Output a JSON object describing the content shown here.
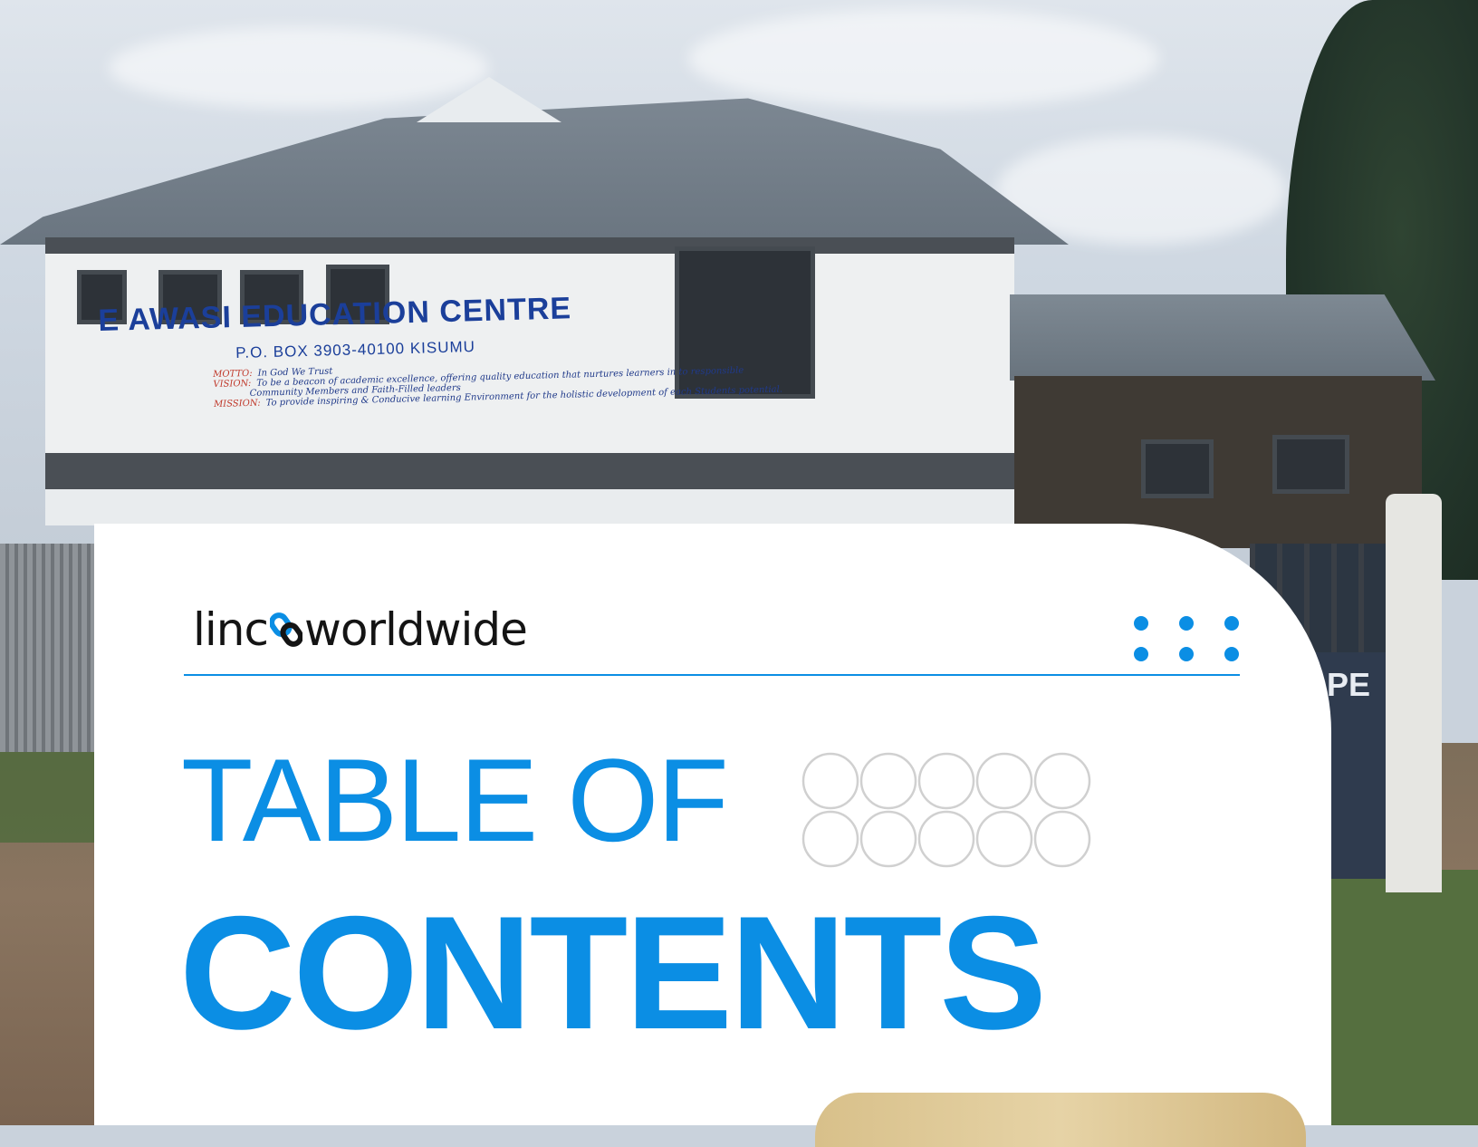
{
  "background_photo": {
    "sign_title": "E  AWASI EDUCATION CENTRE",
    "sign_address": "P.O. BOX 3903-40100 KISUMU",
    "sign_notes": [
      {
        "key": "MOTTO:",
        "text": "In God We Trust"
      },
      {
        "key": "VISION:",
        "text": "To be a beacon of academic excellence, offering quality education that nurtures learners in to responsible"
      },
      {
        "key": "",
        "text": "Community Members and Faith-Filled leaders"
      },
      {
        "key": "MISSION:",
        "text": "To provide inspiring & Conducive learning Environment for the holistic development of each Students potential."
      }
    ],
    "gate_text": "PE"
  },
  "brand": {
    "name_before": "linc",
    "name_after": "worldwide",
    "logo_icon": "chain-link-icon"
  },
  "menu": {
    "icon": "dots-grid-icon"
  },
  "title": {
    "line1": "TABLE OF",
    "line2": "CONTENTS"
  },
  "decor": {
    "circle_grid": "circle-outline-grid"
  },
  "colors": {
    "accent": "#0b8ee4",
    "card": "#ffffff",
    "text_dark": "#141414",
    "circle_outline": "#d0d0d0",
    "gold": "#e0c995"
  }
}
